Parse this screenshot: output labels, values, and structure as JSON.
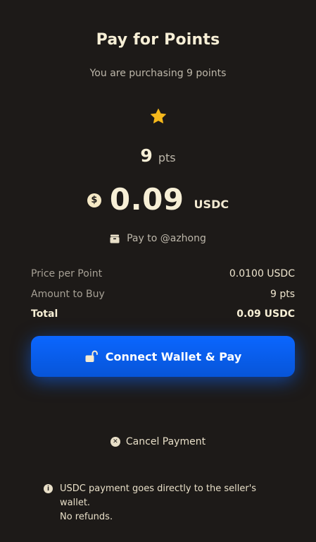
{
  "header": {
    "title": "Pay for Points",
    "subtitle": "You are purchasing 9 points"
  },
  "summary": {
    "star_icon": "star-icon",
    "points_value": "9",
    "points_unit": "pts",
    "amount_value": "0.09",
    "amount_currency": "USDC",
    "currency_icon": "dollar-icon"
  },
  "recipient": {
    "icon": "wallet-icon",
    "label": "Pay to @azhong"
  },
  "details": [
    {
      "label": "Price per Point",
      "value": "0.0100 USDC"
    },
    {
      "label": "Amount to Buy",
      "value": "9 pts"
    },
    {
      "label": "Total",
      "value": "0.09 USDC"
    }
  ],
  "actions": {
    "pay_label": "Connect Wallet & Pay",
    "pay_icon": "unlock-icon",
    "cancel_label": "Cancel Payment",
    "cancel_icon": "close-icon"
  },
  "note": {
    "icon": "info-icon",
    "line1": "USDC payment goes directly to the seller's wallet.",
    "line2": "No refunds."
  },
  "colors": {
    "background": "#1d1a18",
    "accent": "#0b66ff",
    "star": "#f5b81c",
    "text": "#f7efd6"
  }
}
